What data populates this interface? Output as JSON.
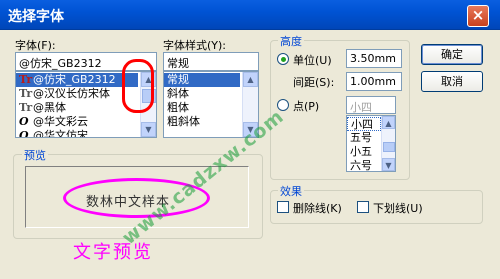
{
  "dialog": {
    "title": "选择字体",
    "close_label": "×"
  },
  "font": {
    "label": "字体(F):",
    "value": "@仿宋_GB2312",
    "items": [
      {
        "icon": "Tr",
        "label": "@仿宋_GB2312",
        "selected": true
      },
      {
        "icon": "Tr",
        "label": "@汉仪长仿宋体",
        "selected": false
      },
      {
        "icon": "Tr",
        "label": "@黑体",
        "selected": false
      },
      {
        "icon": "O",
        "label": "@华文彩云",
        "selected": false
      },
      {
        "icon": "O",
        "label": "@华文仿宋",
        "selected": false
      }
    ]
  },
  "style": {
    "label": "字体样式(Y):",
    "value": "常规",
    "items": [
      {
        "label": "常规",
        "selected": true
      },
      {
        "label": "斜体",
        "selected": false
      },
      {
        "label": "粗体",
        "selected": false
      },
      {
        "label": "粗斜体",
        "selected": false
      }
    ]
  },
  "height": {
    "group_label": "高度",
    "unit_label": "单位(U)",
    "unit_value": "3.50mm",
    "spacing_label": "间距(S):",
    "spacing_value": "1.00mm",
    "point_label": "点(P)",
    "point_value": "小四",
    "point_items": [
      {
        "label": "小四",
        "selected": true
      },
      {
        "label": "五号",
        "selected": false
      },
      {
        "label": "小五",
        "selected": false
      },
      {
        "label": "六号",
        "selected": false
      }
    ]
  },
  "buttons": {
    "ok": "确定",
    "cancel": "取消"
  },
  "preview": {
    "group_label": "预览",
    "sample_text": "数林中文样本",
    "watermark": "www.cadzxw.com",
    "annotation": "文字预览"
  },
  "effects": {
    "group_label": "效果",
    "strike_label": "删除线(K)",
    "underline_label": "下划线(U)"
  },
  "colors": {
    "annotation": "#ff00ff",
    "highlight": "#ff0000",
    "selection": "#316ac5"
  }
}
